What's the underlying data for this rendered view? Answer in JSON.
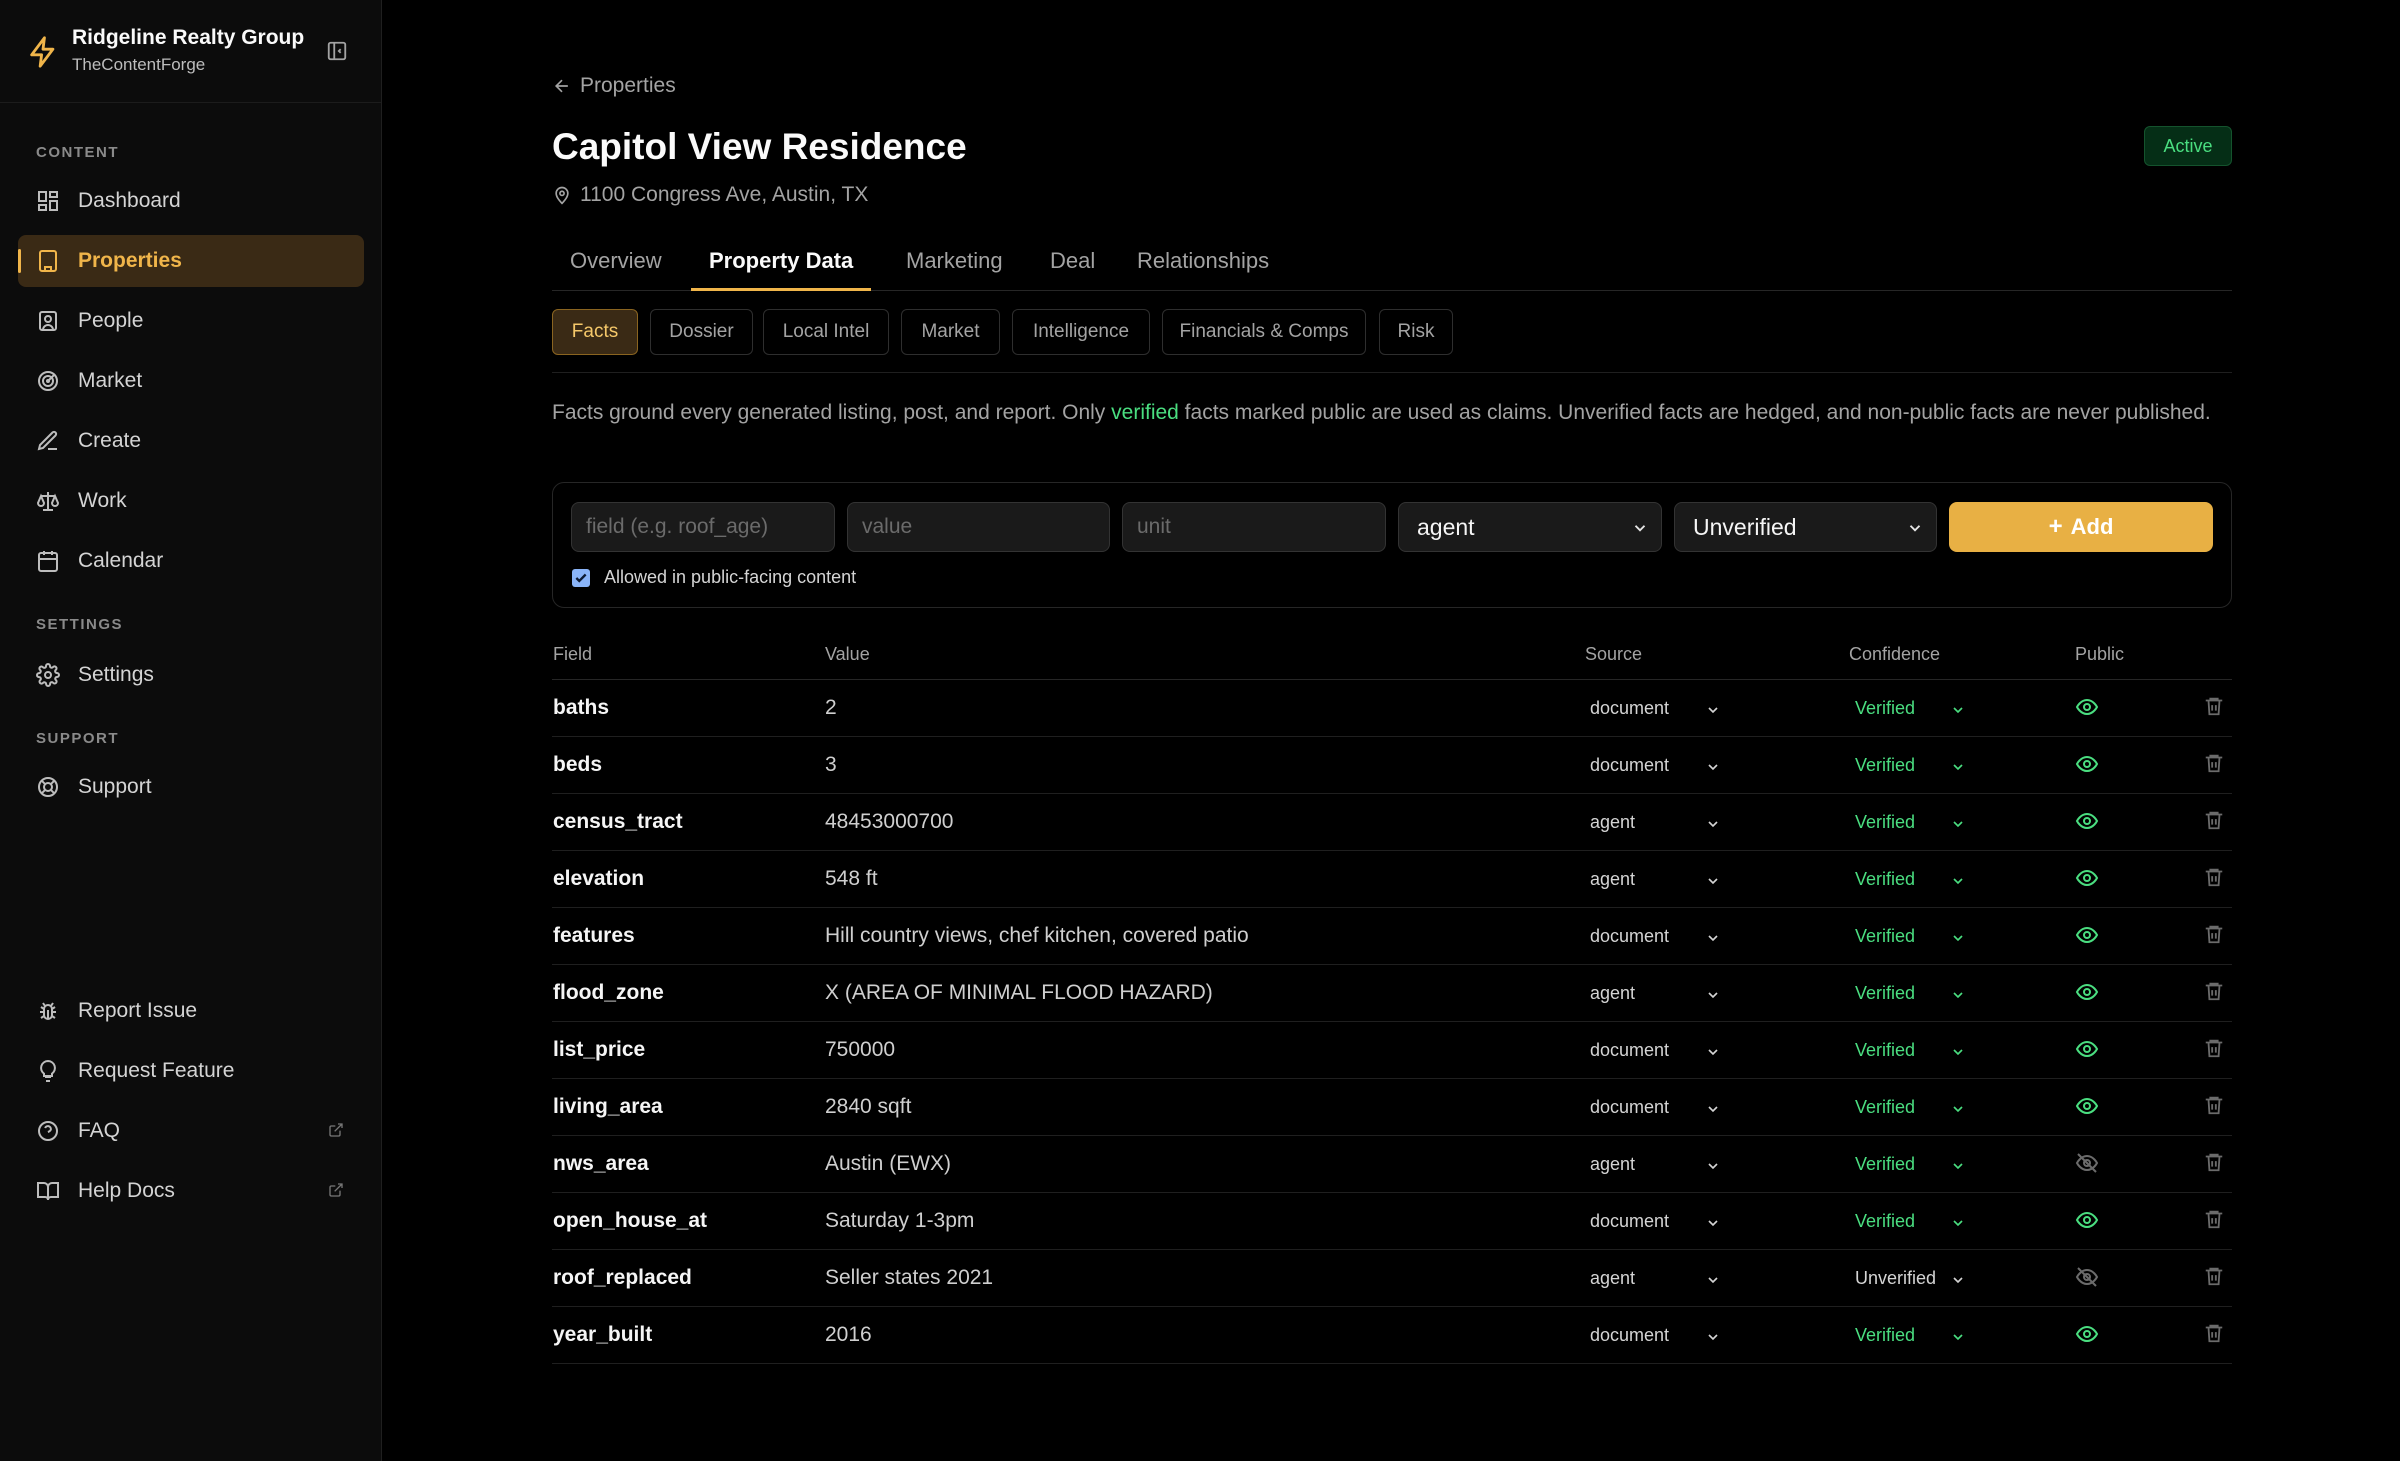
{
  "brand": {
    "name": "Ridgeline Realty Group",
    "sub": "TheContentForge"
  },
  "sidebar": {
    "content_label": "CONTENT",
    "settings_label": "SETTINGS",
    "support_label": "SUPPORT",
    "items": [
      {
        "label": "Dashboard",
        "icon": "dashboard-icon"
      },
      {
        "label": "Properties",
        "icon": "building-icon"
      },
      {
        "label": "People",
        "icon": "contact-icon"
      },
      {
        "label": "Market",
        "icon": "radar-icon"
      },
      {
        "label": "Create",
        "icon": "pen-icon"
      },
      {
        "label": "Work",
        "icon": "scale-icon"
      },
      {
        "label": "Calendar",
        "icon": "calendar-icon"
      },
      {
        "label": "Settings",
        "icon": "gear-icon"
      },
      {
        "label": "Support",
        "icon": "lifebuoy-icon"
      },
      {
        "label": "Report Issue",
        "icon": "bug-icon"
      },
      {
        "label": "Request Feature",
        "icon": "lightbulb-icon"
      },
      {
        "label": "FAQ",
        "icon": "help-circle-icon"
      },
      {
        "label": "Help Docs",
        "icon": "book-icon"
      }
    ]
  },
  "header": {
    "back_label": "Properties",
    "title": "Capitol View Residence",
    "address": "1100 Congress Ave, Austin, TX",
    "status": "Active"
  },
  "tabs": [
    "Overview",
    "Property Data",
    "Marketing",
    "Deal",
    "Relationships"
  ],
  "subtabs": [
    "Facts",
    "Dossier",
    "Local Intel",
    "Market",
    "Intelligence",
    "Financials & Comps",
    "Risk"
  ],
  "description": {
    "before": "Facts ground every generated listing, post, and report. Only ",
    "highlight": "verified",
    "after": " facts marked public are used as claims. Unverified facts are hedged, and non-public facts are never published."
  },
  "form": {
    "field_placeholder": "field (e.g. roof_age)",
    "value_placeholder": "value",
    "unit_placeholder": "unit",
    "source_value": "agent",
    "confidence_value": "Unverified",
    "add_label": "Add",
    "public_label": "Allowed in public-facing content"
  },
  "table": {
    "headers": {
      "field": "Field",
      "value": "Value",
      "source": "Source",
      "confidence": "Confidence",
      "public": "Public"
    },
    "rows": [
      {
        "field": "baths",
        "value": "2",
        "source": "document",
        "confidence": "Verified",
        "public": true
      },
      {
        "field": "beds",
        "value": "3",
        "source": "document",
        "confidence": "Verified",
        "public": true
      },
      {
        "field": "census_tract",
        "value": "48453000700",
        "source": "agent",
        "confidence": "Verified",
        "public": true
      },
      {
        "field": "elevation",
        "value": "548 ft",
        "source": "agent",
        "confidence": "Verified",
        "public": true
      },
      {
        "field": "features",
        "value": "Hill country views, chef kitchen, covered patio",
        "source": "document",
        "confidence": "Verified",
        "public": true
      },
      {
        "field": "flood_zone",
        "value": "X (AREA OF MINIMAL FLOOD HAZARD)",
        "source": "agent",
        "confidence": "Verified",
        "public": true
      },
      {
        "field": "list_price",
        "value": "750000",
        "source": "document",
        "confidence": "Verified",
        "public": true
      },
      {
        "field": "living_area",
        "value": "2840 sqft",
        "source": "document",
        "confidence": "Verified",
        "public": true
      },
      {
        "field": "nws_area",
        "value": "Austin (EWX)",
        "source": "agent",
        "confidence": "Verified",
        "public": false
      },
      {
        "field": "open_house_at",
        "value": "Saturday 1-3pm",
        "source": "document",
        "confidence": "Verified",
        "public": true
      },
      {
        "field": "roof_replaced",
        "value": "Seller states 2021",
        "source": "agent",
        "confidence": "Unverified",
        "public": false
      },
      {
        "field": "year_built",
        "value": "2016",
        "source": "document",
        "confidence": "Verified",
        "public": true
      }
    ]
  },
  "colors": {
    "accent": "#f0b54a",
    "verified": "#4ade80",
    "add_button": "#e8b044"
  }
}
